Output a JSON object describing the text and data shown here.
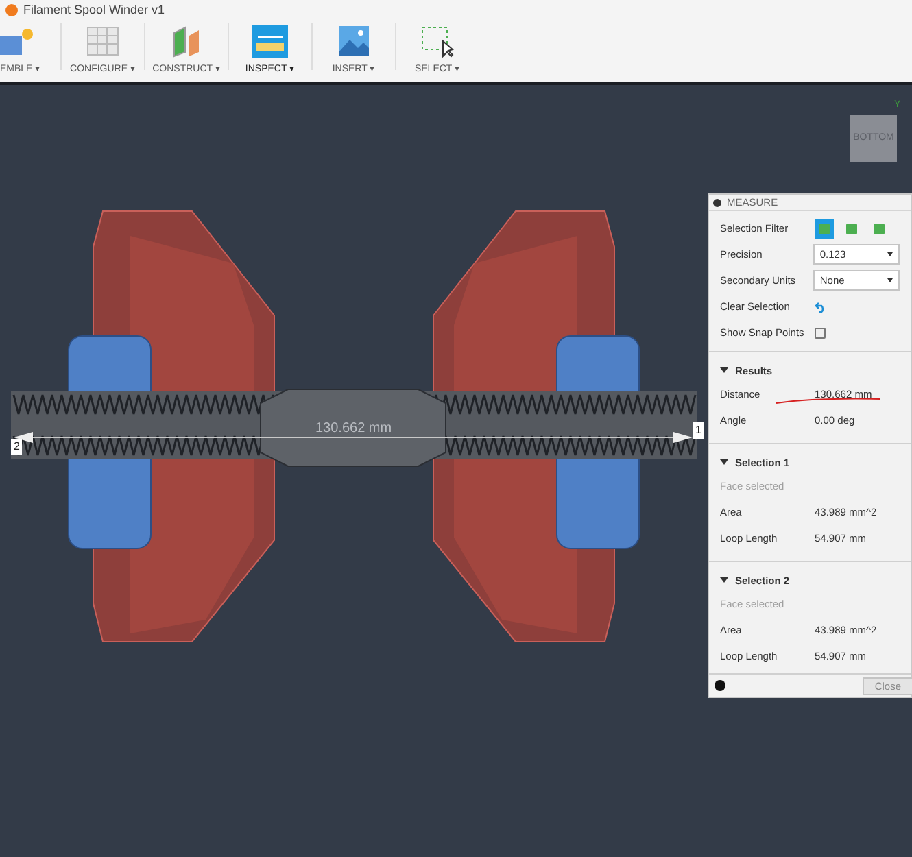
{
  "window": {
    "title": "Filament Spool Winder v1"
  },
  "toolbar": [
    {
      "label": "EMBLE ▾",
      "selected": false
    },
    {
      "label": "CONFIGURE ▾",
      "selected": false
    },
    {
      "label": "CONSTRUCT ▾",
      "selected": false
    },
    {
      "label": "INSPECT ▾",
      "selected": true
    },
    {
      "label": "INSERT ▾",
      "selected": false
    },
    {
      "label": "SELECT ▾",
      "selected": false
    }
  ],
  "viewport": {
    "dimension": "130.662 mm",
    "markers": [
      "2",
      "1"
    ],
    "view_cube": {
      "face": "BOTTOM",
      "axis": "Y"
    }
  },
  "measure": {
    "title": "MEASURE",
    "selection_filter": {
      "label": "Selection Filter",
      "options": [
        {
          "selected": true
        },
        {
          "selected": false
        },
        {
          "selected": false
        }
      ]
    },
    "precision": {
      "label": "Precision",
      "value": "0.123"
    },
    "secondary_units": {
      "label": "Secondary Units",
      "value": "None"
    },
    "clear_selection": {
      "label": "Clear Selection"
    },
    "snap_points": {
      "label": "Show Snap Points",
      "checked": false
    },
    "sections": [
      {
        "title": "Results",
        "expanded": true,
        "rows": [
          {
            "label": "Distance",
            "value": "130.662 mm",
            "underlined": true
          },
          {
            "label": "Angle",
            "value": "0.00 deg",
            "underlined": false
          }
        ]
      },
      {
        "title": "Selection 1",
        "expanded": true,
        "note": "Face selected",
        "rows": [
          {
            "label": "Area",
            "value": "43.989 mm^2",
            "underlined": false
          },
          {
            "label": "Loop Length",
            "value": "54.907 mm",
            "underlined": false
          }
        ]
      },
      {
        "title": "Selection 2",
        "expanded": true,
        "note": "Face selected",
        "rows": [
          {
            "label": "Area",
            "value": "43.989 mm^2",
            "underlined": false
          },
          {
            "label": "Loop Length",
            "value": "54.907 mm",
            "underlined": false
          }
        ]
      }
    ],
    "close": "Close"
  }
}
